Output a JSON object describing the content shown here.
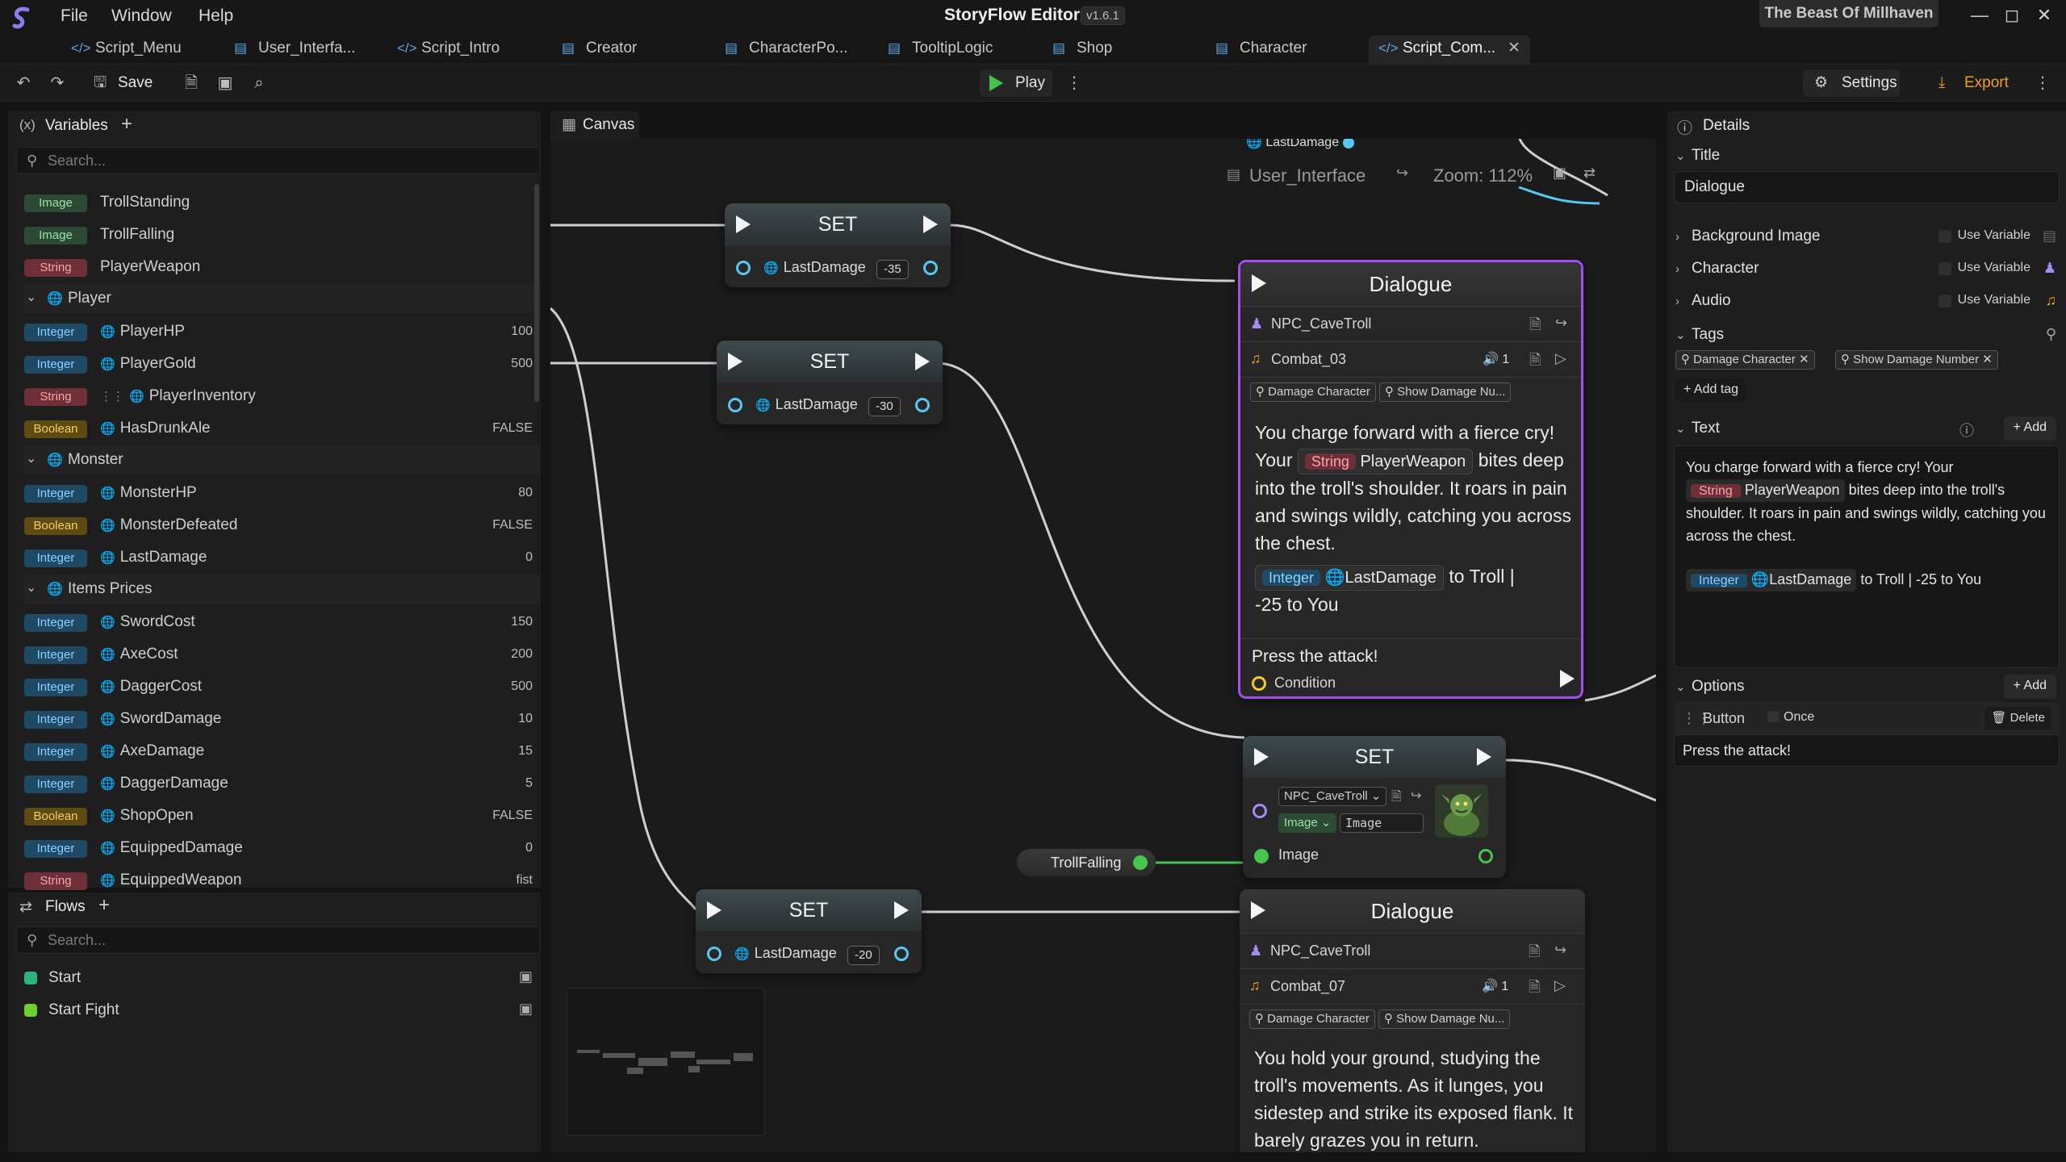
{
  "titlebar": {
    "menu": [
      "File",
      "Window",
      "Help"
    ],
    "app_title": "StoryFlow Editor",
    "version": "v1.6.1",
    "project": "The Beast Of Millhaven"
  },
  "tabs": [
    {
      "label": "Script_Menu",
      "icon": "script-icon"
    },
    {
      "label": "User_Interfa...",
      "icon": "board-icon"
    },
    {
      "label": "Script_Intro",
      "icon": "script-icon"
    },
    {
      "label": "Creator",
      "icon": "board-icon"
    },
    {
      "label": "CharacterPo...",
      "icon": "board-icon"
    },
    {
      "label": "TooltipLogic",
      "icon": "board-icon"
    },
    {
      "label": "Shop",
      "icon": "board-icon"
    },
    {
      "label": "Character",
      "icon": "board-icon"
    },
    {
      "label": "Script_Com...",
      "icon": "script-icon"
    }
  ],
  "toolbar": {
    "save_label": "Save",
    "play_label": "Play",
    "settings_label": "Settings",
    "export_label": "Export"
  },
  "variables": {
    "title": "Variables",
    "search_placeholder": "Search...",
    "rows": [
      {
        "kind": "var",
        "type": "Image",
        "name": "TrollStanding",
        "value": ""
      },
      {
        "kind": "var",
        "type": "Image",
        "name": "TrollFalling",
        "value": ""
      },
      {
        "kind": "var",
        "type": "String",
        "name": "PlayerWeapon",
        "value": ""
      },
      {
        "kind": "group",
        "name": "Player"
      },
      {
        "kind": "var",
        "type": "Integer",
        "name": "PlayerHP",
        "value": "100",
        "global": true
      },
      {
        "kind": "var",
        "type": "Integer",
        "name": "PlayerGold",
        "value": "500",
        "global": true
      },
      {
        "kind": "var",
        "type": "String",
        "name": "PlayerInventory",
        "value": "",
        "global": true
      },
      {
        "kind": "var",
        "type": "Boolean",
        "name": "HasDrunkAle",
        "value": "FALSE",
        "global": true
      },
      {
        "kind": "group",
        "name": "Monster"
      },
      {
        "kind": "var",
        "type": "Integer",
        "name": "MonsterHP",
        "value": "80",
        "global": true
      },
      {
        "kind": "var",
        "type": "Boolean",
        "name": "MonsterDefeated",
        "value": "FALSE",
        "global": true
      },
      {
        "kind": "var",
        "type": "Integer",
        "name": "LastDamage",
        "value": "0",
        "global": true
      },
      {
        "kind": "group",
        "name": "Items Prices"
      },
      {
        "kind": "var",
        "type": "Integer",
        "name": "SwordCost",
        "value": "150",
        "global": true
      },
      {
        "kind": "var",
        "type": "Integer",
        "name": "AxeCost",
        "value": "200",
        "global": true
      },
      {
        "kind": "var",
        "type": "Integer",
        "name": "DaggerCost",
        "value": "500",
        "global": true
      },
      {
        "kind": "var",
        "type": "Integer",
        "name": "SwordDamage",
        "value": "10",
        "global": true
      },
      {
        "kind": "var",
        "type": "Integer",
        "name": "AxeDamage",
        "value": "15",
        "global": true
      },
      {
        "kind": "var",
        "type": "Integer",
        "name": "DaggerDamage",
        "value": "5",
        "global": true
      },
      {
        "kind": "var",
        "type": "Boolean",
        "name": "ShopOpen",
        "value": "FALSE",
        "global": true
      },
      {
        "kind": "var",
        "type": "Integer",
        "name": "EquippedDamage",
        "value": "0",
        "global": true
      },
      {
        "kind": "var",
        "type": "String",
        "name": "EquippedWeapon",
        "value": "fist",
        "global": true
      }
    ]
  },
  "flows": {
    "title": "Flows",
    "search_placeholder": "Search...",
    "items": [
      {
        "name": "Start",
        "color": "#2fb37a"
      },
      {
        "name": "Start Fight",
        "color": "#6fcf2f"
      }
    ]
  },
  "canvas": {
    "tab_label": "Canvas",
    "board_name": "User_Interface",
    "zoom": "Zoom: 112%",
    "top_label": "LastDamage",
    "set_nodes": [
      {
        "title": "SET",
        "var": "LastDamage",
        "value": "-35"
      },
      {
        "title": "SET",
        "var": "LastDamage",
        "value": "-30"
      },
      {
        "title": "SET",
        "var": "LastDamage",
        "value": "-20"
      }
    ],
    "set_image_node": {
      "title": "SET",
      "character": "NPC_CaveTroll",
      "type_label": "Image",
      "field_label": "Image",
      "output_label": "Image"
    },
    "troll_falling_pill": "TrollFalling",
    "dialogue1": {
      "title": "Dialogue",
      "character": "NPC_CaveTroll",
      "audio": "Combat_03",
      "audio_count": "1",
      "tags": [
        "Damage Character",
        "Show Damage Nu..."
      ],
      "text_a": "You charge forward with a fierce cry! Your",
      "pill_type": "String",
      "pill_var": "PlayerWeapon",
      "text_b": "bites deep into the troll's shoulder. It roars in pain and swings wildly, catching you across the chest.",
      "pill2_type": "Integer",
      "pill2_var": "LastDamage",
      "text_c": "to Troll |",
      "text_d": "-25 to You",
      "option_text": "Press the attack!",
      "condition_label": "Condition"
    },
    "dialogue2": {
      "title": "Dialogue",
      "character": "NPC_CaveTroll",
      "audio": "Combat_07",
      "audio_count": "1",
      "tags": [
        "Damage Character",
        "Show Damage Nu..."
      ],
      "text": "You hold your ground, studying the troll's movements. As it lunges, you sidestep and strike its exposed flank. It barely grazes you in return."
    }
  },
  "details": {
    "title": "Details",
    "title_section": "Title",
    "title_value": "Dialogue",
    "background_image": "Background Image",
    "character": "Character",
    "audio": "Audio",
    "use_variable": "Use Variable",
    "tags_label": "Tags",
    "tags": [
      "Damage Character",
      "Show Damage Number"
    ],
    "add_tag": "Add tag",
    "text_label": "Text",
    "add_label": "Add",
    "text_a": "You charge forward with a fierce cry! Your",
    "pill_type": "String",
    "pill_var": "PlayerWeapon",
    "text_b": "bites deep into the troll's shoulder. It roars in pain and swings wildly, catching you across the chest.",
    "pill2_type": "Integer",
    "pill2_var": "LastDamage",
    "text_c": "to Troll | -25 to You",
    "options_label": "Options",
    "option_type": "Button",
    "option_once": "Once",
    "option_delete": "Delete",
    "option_text": "Press the attack!"
  },
  "colors": {
    "accent_green": "#46c44e",
    "dialogue_border": "#a64df0",
    "pin_blue": "#58c8f2",
    "export_orange": "#f0a020"
  }
}
